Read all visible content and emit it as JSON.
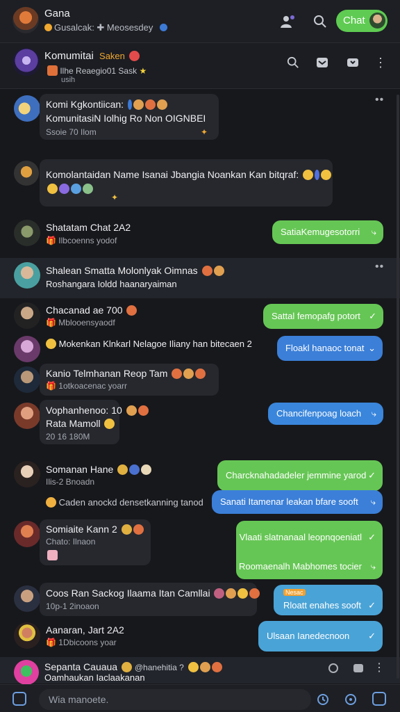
{
  "colors": {
    "green": "#66c655",
    "blue": "#3b7fd8",
    "teal": "#4aa3d6",
    "bg": "#17181c"
  },
  "topbar": {
    "title": "Gana",
    "subtitle": "Gusalcak: ✚ Meosesdey",
    "chat_label": "Chat",
    "icons": [
      "person-plus-icon",
      "search-icon"
    ]
  },
  "group_header": {
    "title": "Komumitai",
    "title_tag": "Saken",
    "subtitle": "Ilhe Reaegio01 Sask",
    "subtitle2": "usih",
    "icons": [
      "search-icon",
      "inbox-icon",
      "video-icon",
      "more-icon"
    ]
  },
  "messages": [
    {
      "name": "Komi Kgkontiican:",
      "text": "KomunitasiN Iolhig Ro Non OIGNBEI",
      "meta": "Ssoie 70 Ilom"
    },
    {
      "name": "",
      "text": "Komolantaidan Name Isanai Jbangia Noankan Kan bitqraf:",
      "meta": ""
    },
    {
      "name": "Shatatam Chat 2A2",
      "text": "",
      "meta": "Ilbcoenns yodof",
      "reply": "SatiaKemugesotorri"
    },
    {
      "name": "Shalean Smatta Molonlyak Oimnas",
      "text": "Roshangara Ioldd haanaryaiman",
      "meta": ""
    },
    {
      "name": "Chacanad ae 700",
      "text": "",
      "meta": "Mblooensyaodf",
      "reply": "Sattal femopafg potort"
    },
    {
      "name": "",
      "text": "Mokenkan Klnkarl Nelagoe Iliany han bitecaen 2",
      "meta": "",
      "reply": "Floakl hanaoc tonat"
    },
    {
      "name": "Kanio Telmhanan Reop Tam",
      "text": "",
      "meta": "1otkoacenac yoarr"
    },
    {
      "name": "Vophanhenoo: 10",
      "text": "Rata Mamoll",
      "meta": "20 16 180M",
      "reply": "Chancifenpoag loach"
    },
    {
      "name": "Somanan Hane",
      "text": "",
      "meta": "Ilis-2 Bnoadn",
      "reply": "Charcknahadadeler jemmine yarod",
      "reply2": "Sanati Itamenar leakan bfare sooft"
    },
    {
      "name": "",
      "text": "Caden anockd densetkanning tanod",
      "meta": ""
    },
    {
      "name": "Somiaite Kann 2",
      "text": "",
      "meta": "Chato: Ilnaon",
      "reply": "Vlaati slatnanaal leopnqoeniatl",
      "reply2": "Roomaenalh Mabhomes tocier"
    },
    {
      "name": "Coos Ran Sackog Ilaama Itan Camllai",
      "text": "",
      "meta": "10p-1 2inoaon",
      "reply": "Rloatt enahes sooft",
      "reply_tag": "Nesac"
    },
    {
      "name": "Aanaran, Jart 2A2",
      "text": "",
      "meta": "1Dbicoons yoar",
      "reply": "Ulsaan Ianedecnoon"
    },
    {
      "name": "Sepanta Cauaua",
      "text": "Oamhaukan Iaclaakanan",
      "meta": "",
      "tag": "@hanehitia ?"
    }
  ],
  "composer": {
    "placeholder": "Wia manoete."
  }
}
